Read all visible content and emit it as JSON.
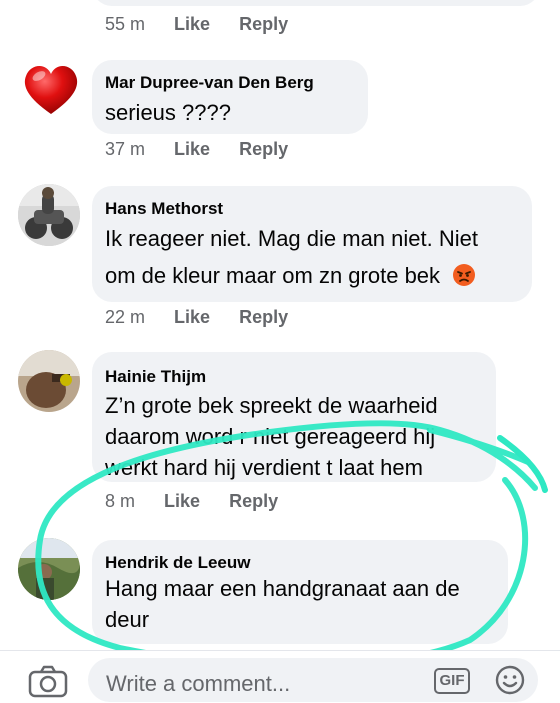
{
  "comments": [
    {
      "time": "55 m",
      "like": "Like",
      "reply": "Reply"
    },
    {
      "name": "Mar Dupree-van Den Berg",
      "text": "serieus ????",
      "time": "37 m",
      "like": "Like",
      "reply": "Reply"
    },
    {
      "name": "Hans Methorst",
      "text_line1": "Ik reageer niet. Mag die man niet. Niet",
      "text_line2": "om de kleur maar om zn grote bek",
      "emoji": "angry-face-icon",
      "time": "22 m",
      "like": "Like",
      "reply": "Reply"
    },
    {
      "name": "Hainie Thijm",
      "text_line1": "Z’n grote bek spreekt de waarheid",
      "text_line2": "daarom word r niet gereageerd hij",
      "text_line3": "werkt hard hij verdient t laat hem",
      "time": "8 m",
      "like": "Like",
      "reply": "Reply"
    },
    {
      "name": "Hendrik de Leeuw",
      "text_line1": "Hang maar een handgranaat aan de",
      "text_line2": "deur"
    }
  ],
  "composer": {
    "placeholder": "Write a comment...",
    "gif_label": "GIF"
  },
  "colors": {
    "bubble": "#f0f2f5",
    "meta": "#65676b",
    "highlight": "#2ee8c3"
  }
}
